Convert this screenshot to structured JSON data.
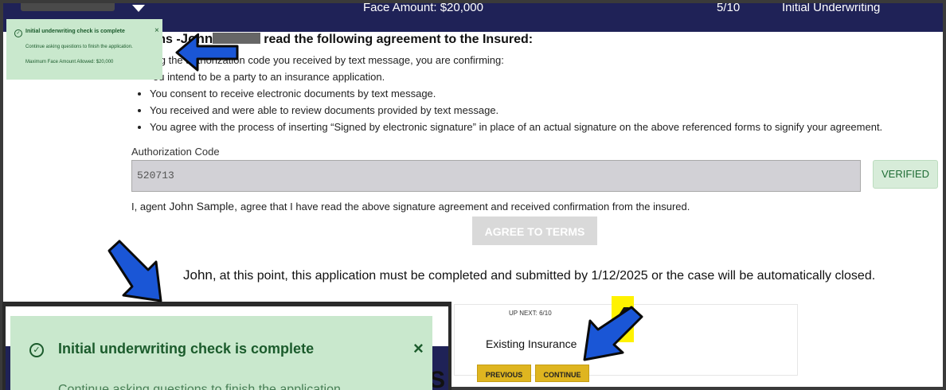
{
  "header": {
    "face_amount": "Face Amount: $20,000",
    "step": "5/10",
    "step_name": "Initial Underwriting"
  },
  "agreement": {
    "instruction_prefix": "uctions -",
    "insured_first_name": "John",
    "instruction_suffix": "read the following agreement to the Insured:",
    "intro": "viding the authorization code you received by text message, you are confirming:",
    "bullets": [
      "ou intend to be a party to an insurance application.",
      "You consent to receive electronic documents by text message.",
      "You received and were able to review documents provided by text message.",
      "You agree with the process of inserting “Signed by electronic signature” in place of an actual signature on the above referenced forms to signify your agreement."
    ]
  },
  "auth": {
    "label": "Authorization Code",
    "value": "520713",
    "status": "VERIFIED"
  },
  "agent": {
    "prefix": "I, agent",
    "name": "John Sample,",
    "suffix": "agree that I have read the above signature agreement and received confirmation from the insured."
  },
  "agree_button": "AGREE TO TERMS",
  "deadline": {
    "name": "John,",
    "text": "at this point, this application must be completed and submitted by 1/12/2025 or the case will be automatically closed."
  },
  "next": {
    "up_next": "UP NEXT: 6/10",
    "name": "Existing Insurance",
    "previous": "PREVIOUS",
    "continue": "CONTINUE"
  },
  "callout_number": "4",
  "toast": {
    "title": "Initial underwriting check is complete",
    "message": "Continue asking questions to finish the application.",
    "max_face": "Maximum Face Amount Allowed: $20,000",
    "close": "×",
    "zoom_message": "Continue asking questions to finish the application."
  },
  "colors": {
    "navy": "#1f2257",
    "toast_green": "#c9e8cd",
    "button_yellow": "#dfb520",
    "arrow_blue": "#1a56d6",
    "callout_yellow": "#fff200"
  },
  "icons": {
    "dropdown": "chevron-down-icon",
    "check": "check-circle-icon",
    "close": "close-icon"
  }
}
